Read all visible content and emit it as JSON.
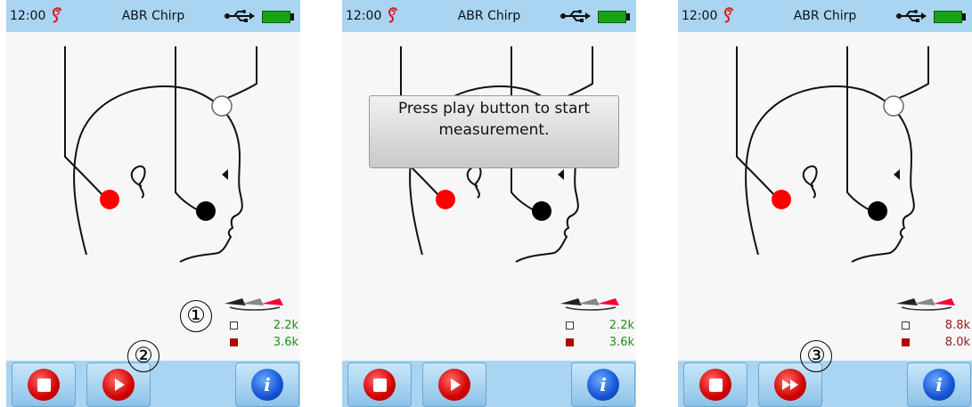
{
  "screens": [
    {
      "time": "12:00",
      "title": "ABR Chirp",
      "message": "",
      "legend": [
        {
          "value": "2.2k",
          "color": "#1b8f1b"
        },
        {
          "value": "3.6k",
          "color": "#1b8f1b"
        }
      ],
      "play_icon": "play-icon"
    },
    {
      "time": "12:00",
      "title": "ABR Chirp",
      "message": "Press play button to start measurement.",
      "legend": [
        {
          "value": "2.2k",
          "color": "#1b8f1b"
        },
        {
          "value": "3.6k",
          "color": "#1b8f1b"
        }
      ],
      "play_icon": "play-icon"
    },
    {
      "time": "12:00",
      "title": "ABR Chirp",
      "message": "",
      "legend": [
        {
          "value": "8.8k",
          "color": "#8f1b1b"
        },
        {
          "value": "8.0k",
          "color": "#8f1b1b"
        }
      ],
      "play_icon": "fast-forward-icon"
    }
  ],
  "callouts": [
    "①",
    "②",
    "③"
  ],
  "colors": {
    "statusbar": "#a9d4f2",
    "electrode_red": "#ff0000",
    "electrode_black": "#000000",
    "impedance_ok": "#1b8f1b",
    "impedance_bad": "#8f1b1b",
    "stop_button": "#d10000",
    "info_button": "#1553d6"
  }
}
